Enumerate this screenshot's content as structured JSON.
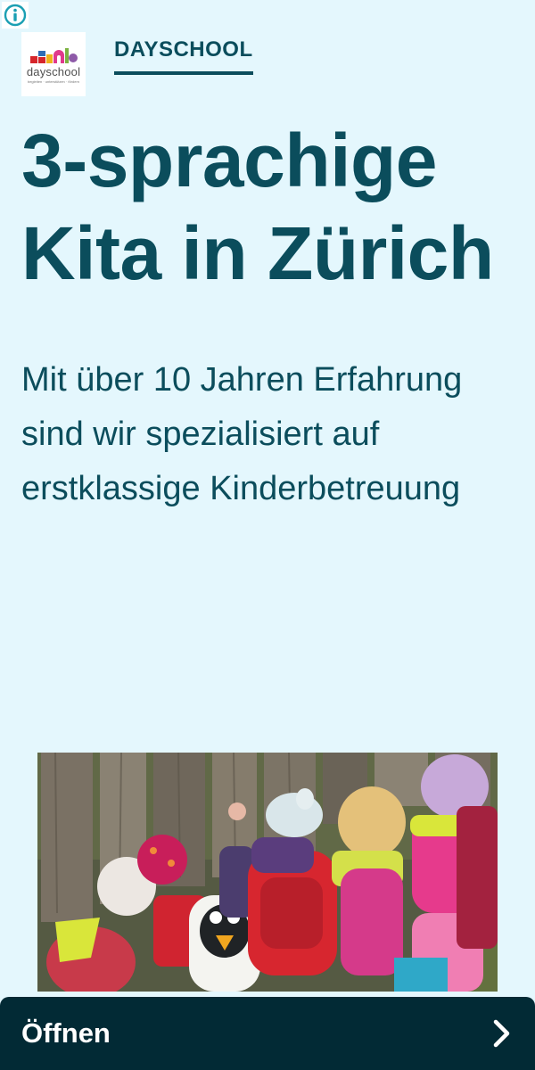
{
  "header": {
    "info_icon": "info-circle-icon",
    "logo": {
      "word": "dayschool",
      "tagline": "begleiten · unterstützen · fördern",
      "colors": [
        "#d6262c",
        "#2f6db5",
        "#f0b21b",
        "#e03a8c",
        "#7cb342",
        "#8e5aa8"
      ]
    },
    "brand_name": "DAYSCHOOL"
  },
  "main": {
    "headline": "3-sprachige Kita in Zürich",
    "subtitle": "Mit über 10 Jahren Erfahrung sind wir spezialisiert auf erstklassige Kinderbetreuung",
    "image": {
      "description_icon": "photo-children-at-fence"
    }
  },
  "cta": {
    "label": "Öffnen",
    "icon": "chevron-right-icon"
  },
  "colors": {
    "background": "#e4f7fd",
    "text": "#0b4d5c",
    "cta_background": "#022a35",
    "info_icon": "#1a9fb3"
  }
}
